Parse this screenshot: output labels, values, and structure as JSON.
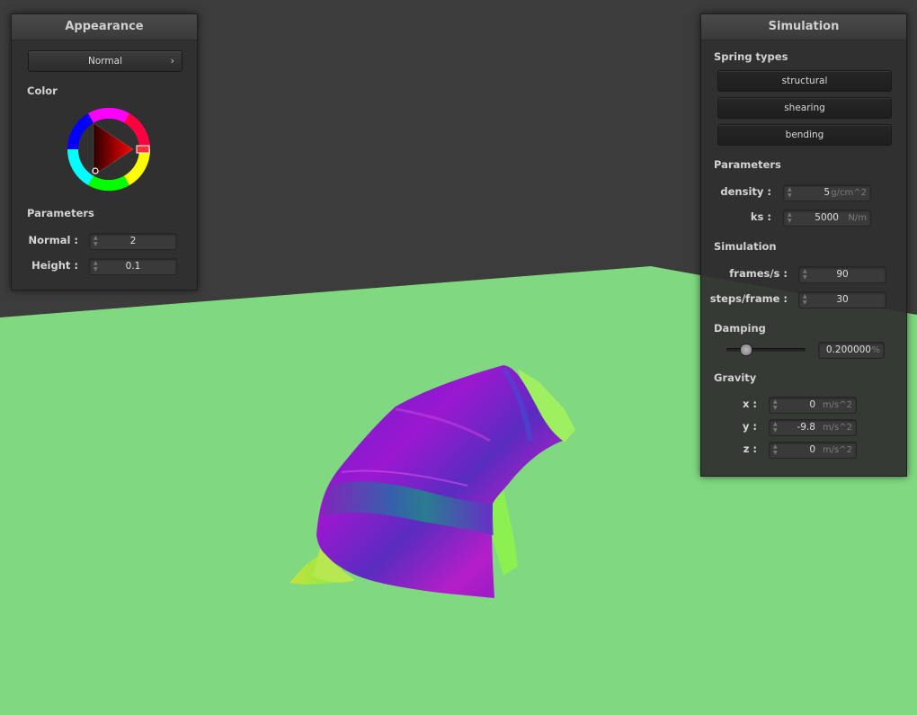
{
  "appearance": {
    "title": "Appearance",
    "shader_select": "Normal",
    "color_label": "Color",
    "params_label": "Parameters",
    "normal_label": "Normal :",
    "normal_value": "2",
    "height_label": "Height :",
    "height_value": "0.1",
    "color": "#ff0000"
  },
  "simulation": {
    "title": "Simulation",
    "spring_types_label": "Spring types",
    "spring_types": [
      "structural",
      "shearing",
      "bending"
    ],
    "params_label": "Parameters",
    "density_label": "density :",
    "density_value": "5",
    "density_unit": "g/cm^2",
    "ks_label": "ks :",
    "ks_value": "5000",
    "ks_unit": "N/m",
    "sim_label": "Simulation",
    "fps_label": "frames/s :",
    "fps_value": "90",
    "steps_label": "steps/frame :",
    "steps_value": "30",
    "damping_label": "Damping",
    "damping_value": "0.200000",
    "damping_unit": "%",
    "damping_fraction": 0.2,
    "gravity_label": "Gravity",
    "gx_label": "x :",
    "gx_value": "0",
    "gx_unit": "m/s^2",
    "gy_label": "y :",
    "gy_value": "-9.8",
    "gy_unit": "m/s^2",
    "gz_label": "z :",
    "gz_value": "0",
    "gz_unit": "m/s^2"
  },
  "colors": {
    "background": "#3c3c3c",
    "ground": "#80d880",
    "cloth_purple": "#8a18c8",
    "cloth_green": "#a0f060"
  }
}
